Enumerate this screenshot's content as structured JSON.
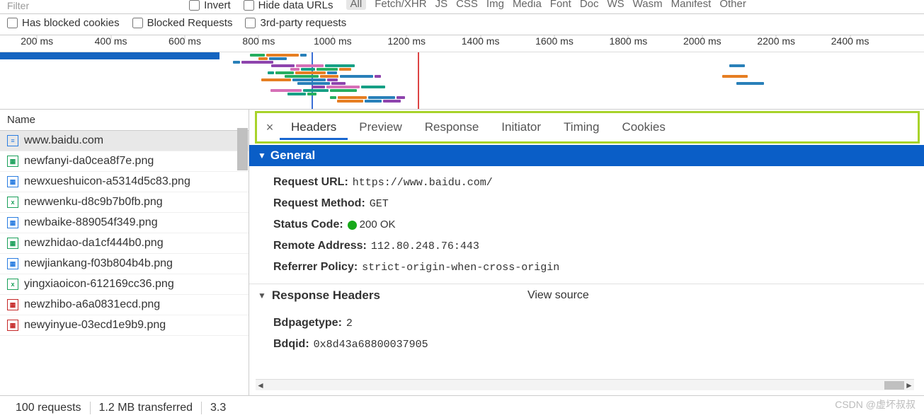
{
  "filter": {
    "placeholder": "Filter",
    "invert": "Invert",
    "hide_data_urls": "Hide data URLs",
    "types": [
      "All",
      "Fetch/XHR",
      "JS",
      "CSS",
      "Img",
      "Media",
      "Font",
      "Doc",
      "WS",
      "Wasm",
      "Manifest",
      "Other"
    ],
    "selected_type": "All",
    "has_blocked_cookies": "Has blocked cookies",
    "blocked_requests": "Blocked Requests",
    "third_party": "3rd-party requests"
  },
  "timeline": {
    "ticks": [
      "200 ms",
      "400 ms",
      "600 ms",
      "800 ms",
      "1000 ms",
      "1200 ms",
      "1400 ms",
      "1600 ms",
      "1800 ms",
      "2000 ms",
      "2200 ms",
      "2400 ms"
    ],
    "marker_blue_at": 440,
    "marker_red_at": 590,
    "progress_width": 310
  },
  "left_panel": {
    "header": "Name",
    "selected_index": 0,
    "rows": [
      {
        "icon": "doc",
        "icon_class": "ic-doc",
        "text": "www.baidu.com"
      },
      {
        "icon": "img",
        "icon_class": "ic-img",
        "text": "newfanyi-da0cea8f7e.png"
      },
      {
        "icon": "img",
        "icon_class": "ic-blue",
        "text": "newxueshuicon-a5314d5c83.png"
      },
      {
        "icon": "x",
        "icon_class": "ic-x",
        "text": "newwenku-d8c9b7b0fb.png"
      },
      {
        "icon": "img",
        "icon_class": "ic-blue",
        "text": "newbaike-889054f349.png"
      },
      {
        "icon": "img",
        "icon_class": "ic-img",
        "text": "newzhidao-da1cf444b0.png"
      },
      {
        "icon": "img",
        "icon_class": "ic-blue",
        "text": "newjiankang-f03b804b4b.png"
      },
      {
        "icon": "x",
        "icon_class": "ic-x",
        "text": "yingxiaoicon-612169cc36.png"
      },
      {
        "icon": "img",
        "icon_class": "ic-red",
        "text": "newzhibo-a6a0831ecd.png"
      },
      {
        "icon": "img",
        "icon_class": "ic-red",
        "text": "newyinyue-03ecd1e9b9.png"
      }
    ]
  },
  "detail_tabs": {
    "items": [
      "Headers",
      "Preview",
      "Response",
      "Initiator",
      "Timing",
      "Cookies"
    ],
    "active": "Headers"
  },
  "general": {
    "title": "General",
    "request_url_k": "Request URL:",
    "request_url_v": "https://www.baidu.com/",
    "request_method_k": "Request Method:",
    "request_method_v": "GET",
    "status_code_k": "Status Code:",
    "status_code_v": "200 OK",
    "remote_addr_k": "Remote Address:",
    "remote_addr_v": "112.80.248.76:443",
    "referrer_k": "Referrer Policy:",
    "referrer_v": "strict-origin-when-cross-origin"
  },
  "response_headers": {
    "title": "Response Headers",
    "view_source": "View source",
    "rows": [
      {
        "k": "Bdpagetype:",
        "v": "2"
      },
      {
        "k": "Bdqid:",
        "v": "0x8d43a68800037905"
      }
    ]
  },
  "footer": {
    "requests": "100 requests",
    "transferred": "1.2 MB transferred",
    "extra": "3.3"
  },
  "watermark": "CSDN @虚坏叔叔"
}
